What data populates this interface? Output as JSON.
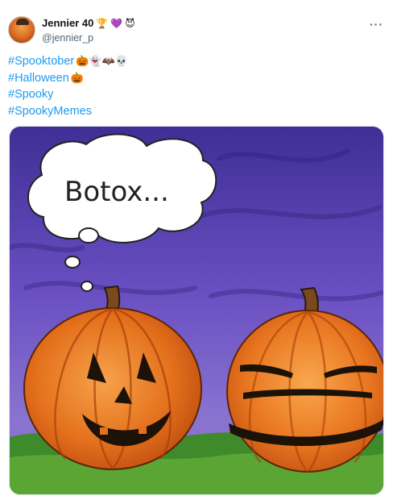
{
  "post": {
    "author": {
      "display_name": "Jennier 40",
      "badges": [
        "🏆",
        "💜",
        "😈"
      ],
      "handle": "@jennier_p"
    },
    "more_label": "···",
    "hashtags": [
      {
        "text": "#Spooktober",
        "emojis": "🎃👻🦇💀"
      },
      {
        "text": "#Halloween",
        "emojis": "🎃"
      },
      {
        "text": "#Spooky",
        "emojis": ""
      },
      {
        "text": "#SpookyMemes",
        "emojis": ""
      }
    ],
    "image": {
      "thought_text": "Botox..."
    }
  },
  "colors": {
    "link": "#1d9bf0",
    "secondary_text": "#536471",
    "sky": "#5b46b5",
    "pumpkin": "#e8741f"
  }
}
